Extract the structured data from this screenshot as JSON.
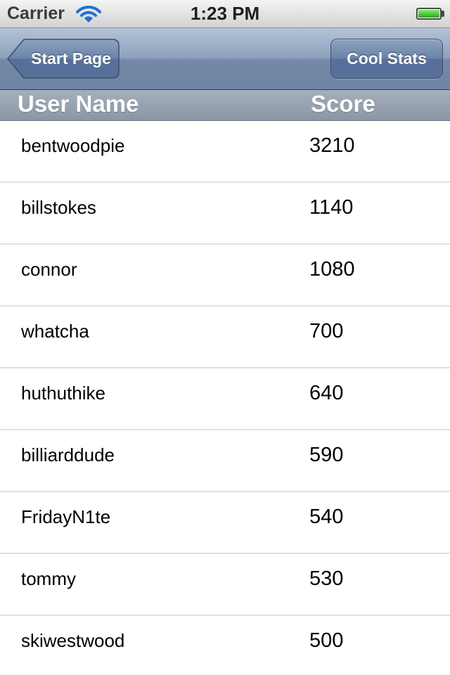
{
  "status_bar": {
    "carrier": "Carrier",
    "time": "1:23 PM",
    "battery_level": 1.0
  },
  "nav_bar": {
    "back_label": "Start Page",
    "right_label": "Cool Stats"
  },
  "column_headers": {
    "user_name": "User Name",
    "score": "Score"
  },
  "rows": [
    {
      "name": "bentwoodpie",
      "score": "3210"
    },
    {
      "name": "billstokes",
      "score": "1140"
    },
    {
      "name": "connor",
      "score": "1080"
    },
    {
      "name": "whatcha",
      "score": "700"
    },
    {
      "name": "huthuthike",
      "score": "640"
    },
    {
      "name": "billiarddude",
      "score": "590"
    },
    {
      "name": "FridayN1te",
      "score": "540"
    },
    {
      "name": "tommy",
      "score": "530"
    },
    {
      "name": "skiwestwood",
      "score": "500"
    }
  ],
  "colors": {
    "nav_bar": "#8ea2bd",
    "header_bar": "#97a2b0",
    "battery_fill": "#2ea51e",
    "wifi": "#1f6fd6"
  },
  "icons": {
    "wifi": "wifi-icon",
    "battery": "battery-icon",
    "back_chevron": "back-arrow-icon"
  }
}
